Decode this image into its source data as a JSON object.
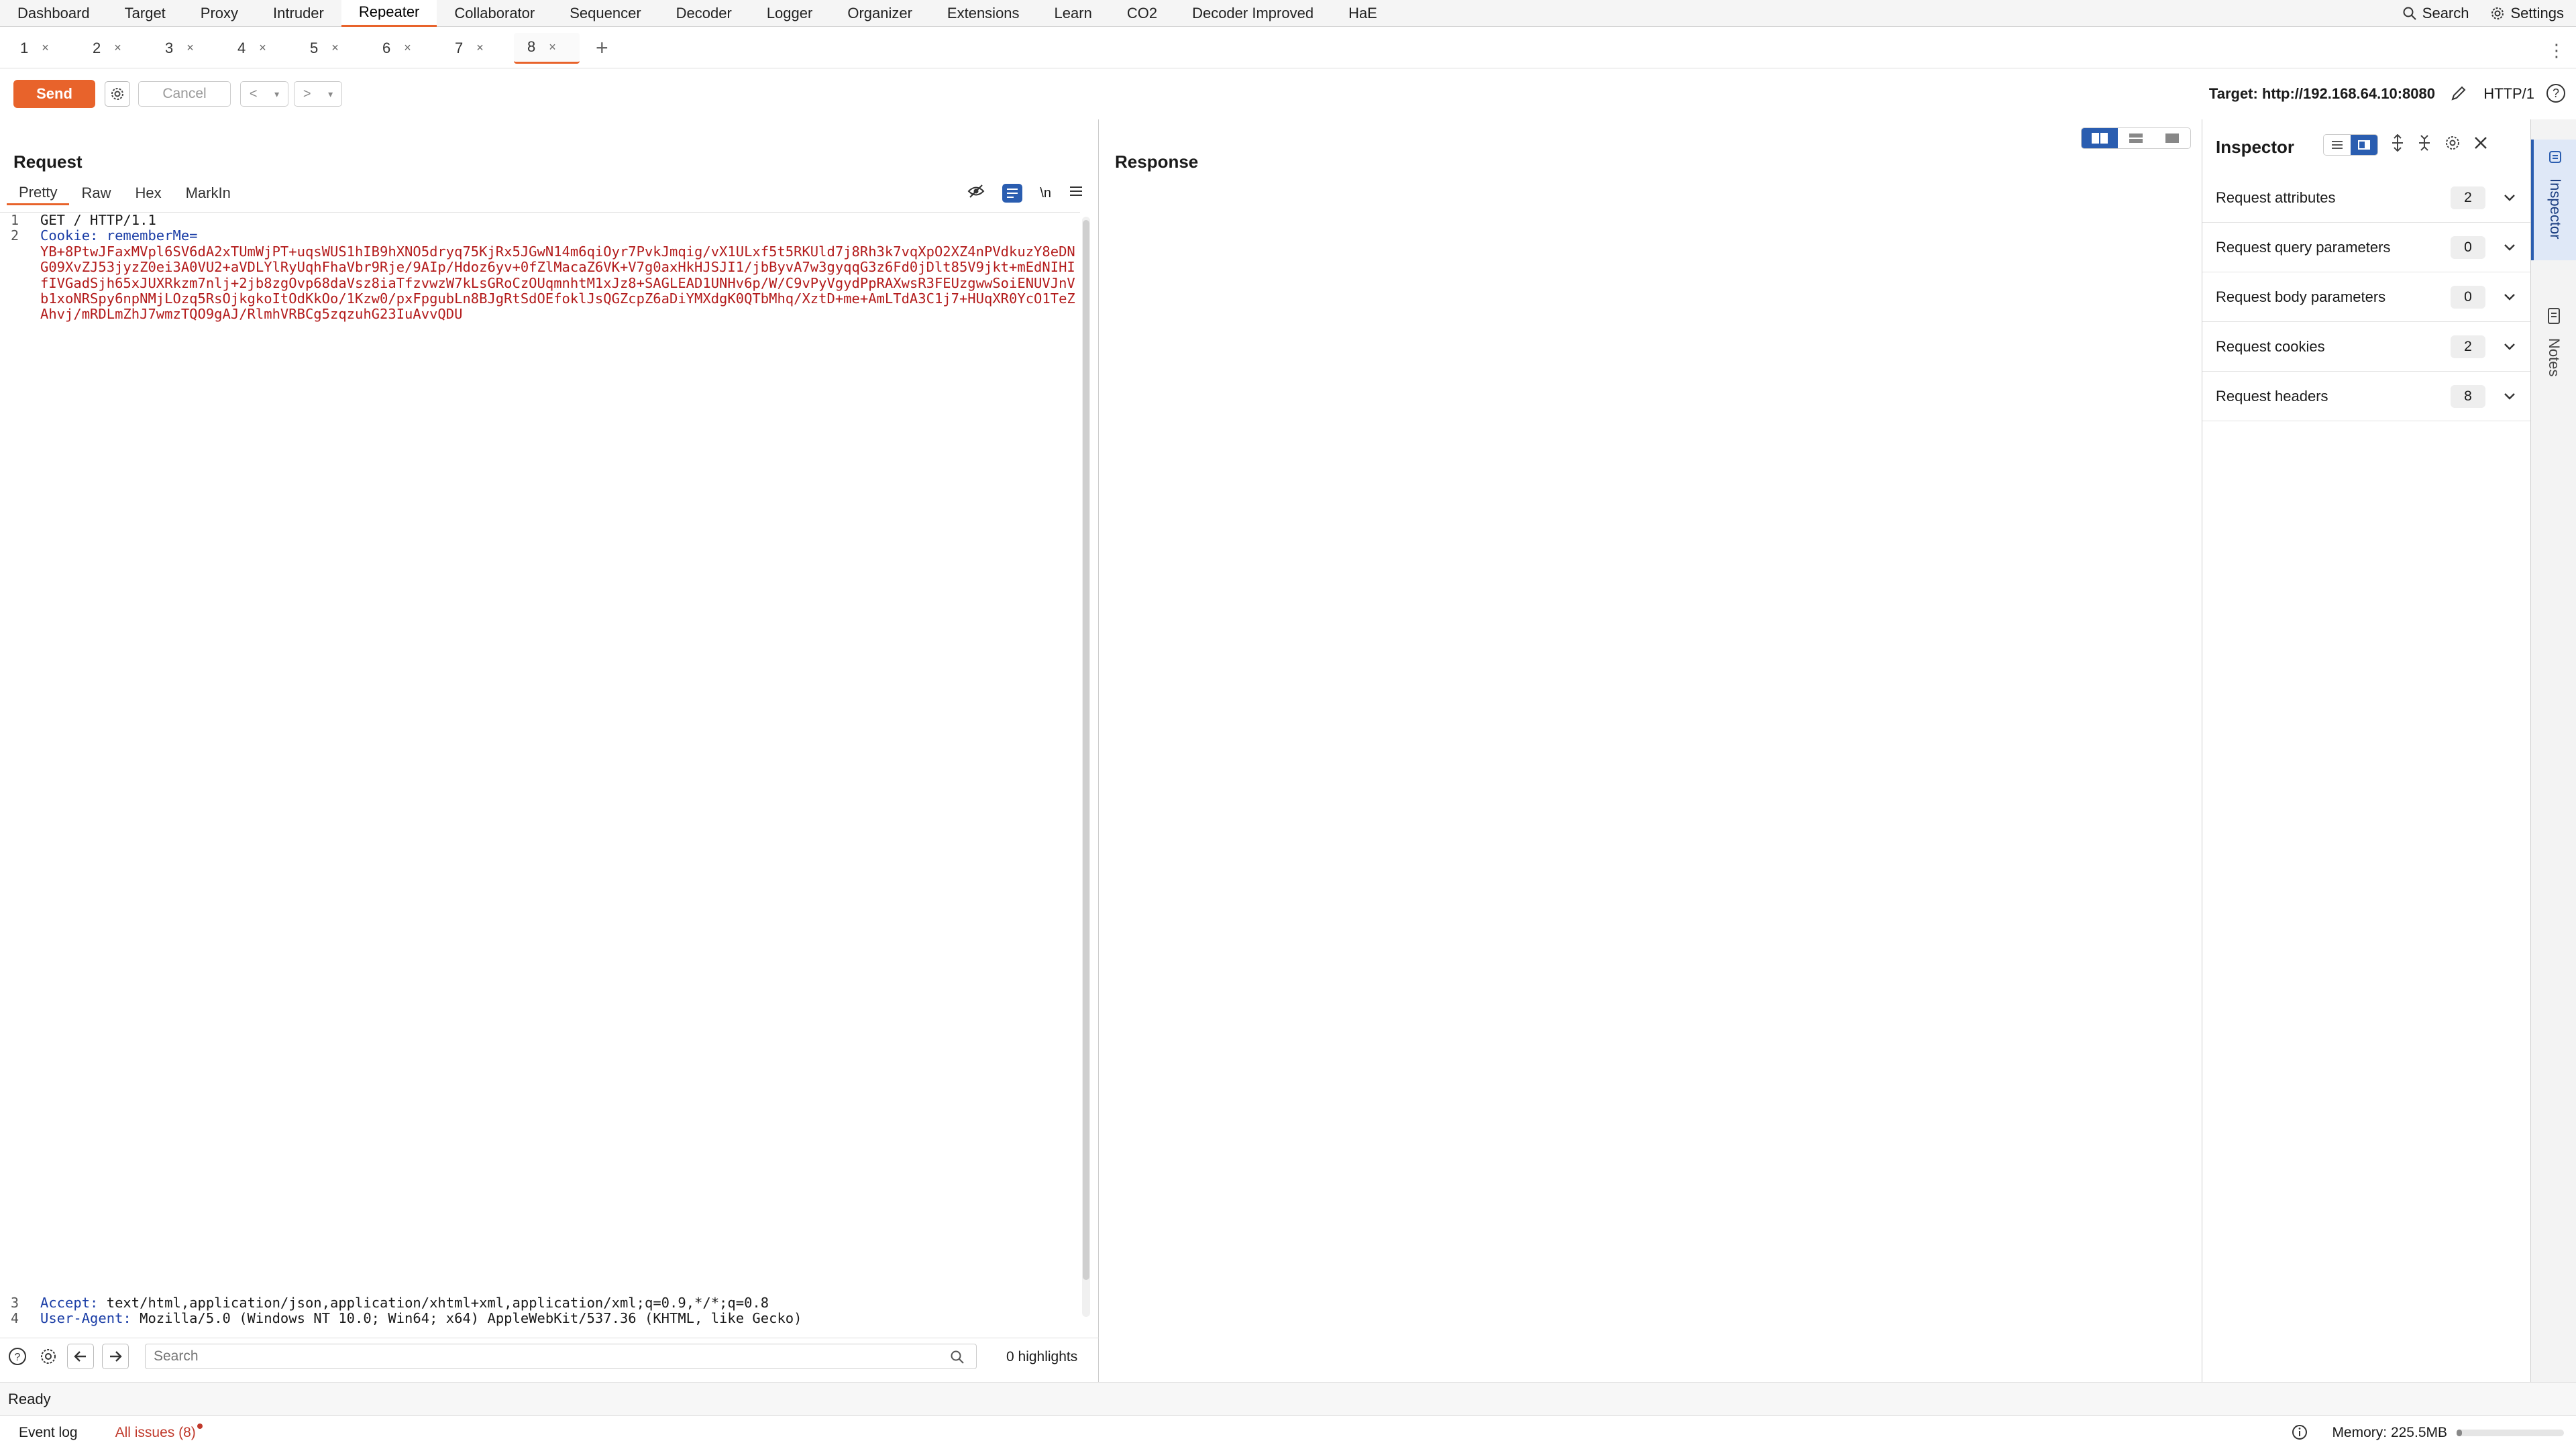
{
  "nav": {
    "tabs": [
      "Dashboard",
      "Target",
      "Proxy",
      "Intruder",
      "Repeater",
      "Collaborator",
      "Sequencer",
      "Decoder",
      "Logger",
      "Organizer",
      "Extensions",
      "Learn",
      "CO2",
      "Decoder Improved",
      "HaE"
    ],
    "active": "Repeater",
    "search_label": "Search",
    "settings_label": "Settings"
  },
  "subtabs": [
    {
      "label": "1",
      "close": "×"
    },
    {
      "label": "2",
      "close": "×"
    },
    {
      "label": "3",
      "close": "×"
    },
    {
      "label": "4",
      "close": "×"
    },
    {
      "label": "5",
      "close": "×"
    },
    {
      "label": "6",
      "close": "×"
    },
    {
      "label": "7",
      "close": "×"
    },
    {
      "label": "8",
      "close": "×"
    }
  ],
  "subtab_active": "8",
  "subtab_add": "+",
  "toolbar": {
    "send_label": "Send",
    "cancel_label": "Cancel",
    "prev_arrow": "<",
    "next_arrow": ">",
    "dropdown": "▾",
    "target_label": "Target: http://192.168.64.10:8080",
    "http_version": "HTTP/1"
  },
  "request": {
    "title": "Request",
    "tabs": [
      "Pretty",
      "Raw",
      "Hex",
      "MarkIn"
    ],
    "active_tab": "Pretty",
    "newline_label": "\\n",
    "line1": "GET / HTTP/1.1",
    "line2_key": "Cookie:",
    "line2_name": "rememberMe=",
    "cookie_value": "YB+8PtwJFaxMVpl6SV6dA2xTUmWjPT+uqsWUS1hIB9hXNO5dryq75KjRx5JGwN14m6qiOyr7PvkJmqig/vX1ULxf5t5RKUld7j8Rh3k7vqXpO2XZ4nPVdkuzY8eDNG09XvZJ53jyzZ0ei3A0VU2+aVDLYlRyUqhFhaVbr9Rje/9AIp/Hdoz6yv+0fZlMacaZ6VK+V7g0axHkHJSJI1/jbByvA7w3gyqqG3z6Fd0jDlt85V9jkt+mEdNIHIfIVGadSjh65xJUXRkzm7nlj+2jb8zgOvp68daVsz8iaTfzvwzW7kLsGRoCzOUqmnhtM1xJz8+SAGLEAD1UNHv6p/W/C9vPyVgydPpRAXwsR3FEUzgwwSoiENUVJnVb1xoNRSpy6npNMjLOzq5RsOjkgkoItOdKkOo/1Kzw0/pxFpgubLn8BJgRtSdOEfoklJsQGZcpZ6aDiYMXdgK0QTbMhq/XztD+me+AmLTdA3C1j7+HUqXR0YcO1TeZAhvj/mRDLmZhJ7wmzTQO9gAJ/RlmhVRBCg5zqzuhG23IuAvvQDU",
    "line3_key": "Accept:",
    "line3_val": "text/html,application/json,application/xhtml+xml,application/xml;q=0.9,*/*;q=0.8",
    "line4_key": "User-Agent:",
    "line4_val": "Mozilla/5.0 (Windows NT 10.0; Win64; x64) AppleWebKit/537.36 (KHTML, like Gecko)",
    "line_numbers": [
      "1",
      "2",
      "3",
      "4"
    ],
    "search_placeholder": "Search",
    "highlights": "0 highlights"
  },
  "response": {
    "title": "Response"
  },
  "inspector": {
    "title": "Inspector",
    "rows": [
      {
        "label": "Request attributes",
        "count": "2"
      },
      {
        "label": "Request query parameters",
        "count": "0"
      },
      {
        "label": "Request body parameters",
        "count": "0"
      },
      {
        "label": "Request cookies",
        "count": "2"
      },
      {
        "label": "Request headers",
        "count": "8"
      }
    ],
    "side_tabs": [
      "Inspector",
      "Notes"
    ]
  },
  "status": {
    "ready": "Ready",
    "event_log": "Event log",
    "all_issues": "All issues (8)",
    "memory": "Memory: 225.5MB"
  },
  "colors": {
    "accent": "#e8632b",
    "blue": "#2a5db0",
    "cookie_value": "#b31b1b",
    "header_key": "#1a3da6"
  }
}
